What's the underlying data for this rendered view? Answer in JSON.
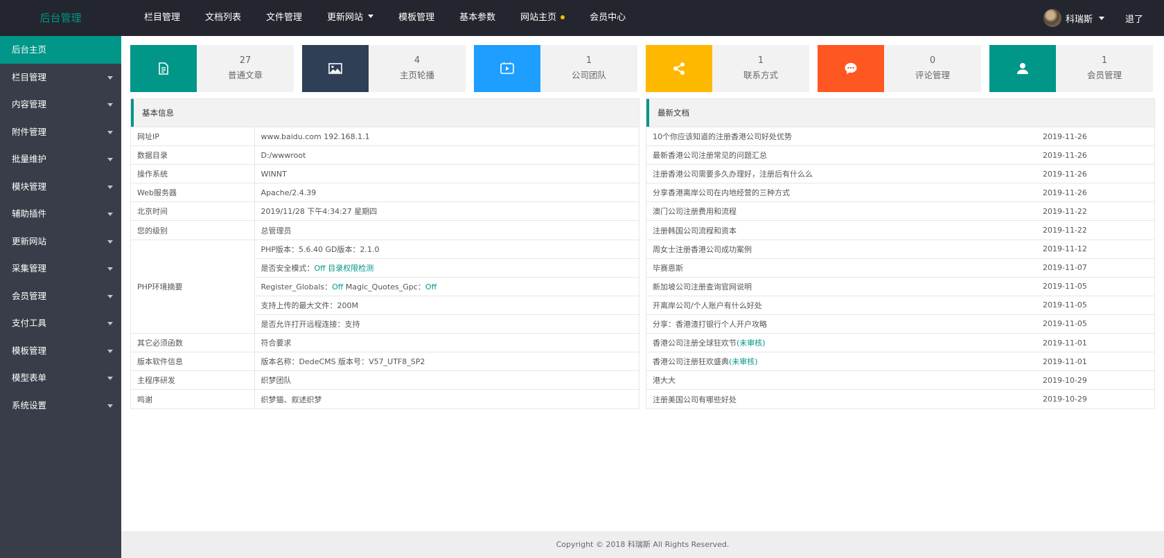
{
  "header": {
    "logo": "后台管理",
    "nav": [
      {
        "label": "栏目管理"
      },
      {
        "label": "文档列表"
      },
      {
        "label": "文件管理"
      },
      {
        "label": "更新网站",
        "has_caret": true
      },
      {
        "label": "模板管理"
      },
      {
        "label": "基本参数"
      },
      {
        "label": "网站主页",
        "has_dot": true
      },
      {
        "label": "会员中心"
      }
    ],
    "user_name": "科瑞斯",
    "logout": "退了"
  },
  "sidebar": {
    "items": [
      {
        "label": "后台主页",
        "active": true
      },
      {
        "label": "栏目管理"
      },
      {
        "label": "内容管理"
      },
      {
        "label": "附件管理"
      },
      {
        "label": "批量维护"
      },
      {
        "label": "模块管理"
      },
      {
        "label": "辅助插件"
      },
      {
        "label": "更新网站"
      },
      {
        "label": "采集管理"
      },
      {
        "label": "会员管理"
      },
      {
        "label": "支付工具"
      },
      {
        "label": "模板管理"
      },
      {
        "label": "模型表单"
      },
      {
        "label": "系统设置"
      }
    ]
  },
  "cards": [
    {
      "count": "27",
      "label": "普通文章",
      "color": "#009688",
      "icon": "document-icon"
    },
    {
      "count": "4",
      "label": "主页轮播",
      "color": "#2f4056",
      "icon": "image-icon"
    },
    {
      "count": "1",
      "label": "公司团队",
      "color": "#1e9fff",
      "icon": "video-icon"
    },
    {
      "count": "1",
      "label": "联系方式",
      "color": "#ffb800",
      "icon": "share-icon"
    },
    {
      "count": "0",
      "label": "评论管理",
      "color": "#ff5722",
      "icon": "comment-icon"
    },
    {
      "count": "1",
      "label": "会员管理",
      "color": "#009688",
      "icon": "user-icon"
    }
  ],
  "basic_info": {
    "title": "基本信息",
    "rows": [
      {
        "key": "网址IP",
        "value": "www.baidu.com 192.168.1.1"
      },
      {
        "key": "数据目录",
        "value": "D:/wwwroot"
      },
      {
        "key": "操作系统",
        "value": "WINNT"
      },
      {
        "key": "Web服务器",
        "value": "Apache/2.4.39"
      },
      {
        "key": "北京时间",
        "value": "2019/11/28 下午4:34:27 星期四"
      },
      {
        "key": "您的级别",
        "value": "总管理员"
      }
    ],
    "php": {
      "key": "PHP环境摘要",
      "line1": "PHP版本：5.6.40 GD版本：2.1.0",
      "line2_prefix": "是否安全模式：",
      "line2_off": "Off",
      "line2_link": "目录权限检测",
      "line3_a": "Register_Globals：",
      "line3_off1": "Off",
      "line3_b": " Magic_Quotes_Gpc：",
      "line3_off2": "Off",
      "line4": "支持上传的最大文件：200M",
      "line5": "是否允许打开远程连接：支持"
    },
    "rows2": [
      {
        "key": "其它必须函数",
        "value": "符合要求"
      },
      {
        "key": "版本软件信息",
        "value": "版本名称：DedeCMS 版本号：V57_UTF8_SP2"
      },
      {
        "key": "主程序研发",
        "value": "织梦团队"
      },
      {
        "key": "鸣谢",
        "value": "织梦猫、叙述织梦"
      }
    ]
  },
  "latest_docs": {
    "title": "最新文档",
    "items": [
      {
        "title": "10个你应该知道的注册香港公司好处优势",
        "date": "2019-11-26",
        "note": ""
      },
      {
        "title": "最新香港公司注册常见的问题汇总",
        "date": "2019-11-26",
        "note": ""
      },
      {
        "title": "注册香港公司需要多久办理好，注册后有什么么",
        "date": "2019-11-26",
        "note": ""
      },
      {
        "title": "分享香港离岸公司在内地经营的三种方式",
        "date": "2019-11-26",
        "note": ""
      },
      {
        "title": "澳门公司注册费用和流程",
        "date": "2019-11-22",
        "note": ""
      },
      {
        "title": "注册韩国公司流程和资本",
        "date": "2019-11-22",
        "note": ""
      },
      {
        "title": "周女士注册香港公司成功案例",
        "date": "2019-11-12",
        "note": ""
      },
      {
        "title": "毕赛恩斯",
        "date": "2019-11-07",
        "note": ""
      },
      {
        "title": "新加坡公司注册查询官网说明",
        "date": "2019-11-05",
        "note": ""
      },
      {
        "title": "开离岸公司/个人账户有什么好处",
        "date": "2019-11-05",
        "note": ""
      },
      {
        "title": "分享：香港渣打银行个人开户攻略",
        "date": "2019-11-05",
        "note": ""
      },
      {
        "title": "香港公司注册全球狂欢节",
        "date": "2019-11-01",
        "note": "(未审核)"
      },
      {
        "title": "香港公司注册狂欢盛典",
        "date": "2019-11-01",
        "note": "(未审核)"
      },
      {
        "title": "港大大",
        "date": "2019-10-29",
        "note": ""
      },
      {
        "title": "注册美国公司有哪些好处",
        "date": "2019-10-29",
        "note": ""
      }
    ]
  },
  "footer": "Copyright © 2018 科瑞斯 All Rights Reserved."
}
